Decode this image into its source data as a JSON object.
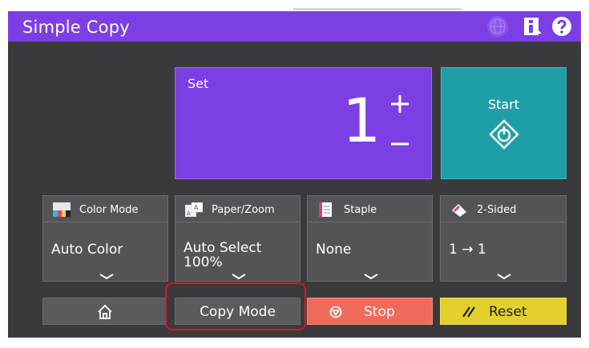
{
  "app": {
    "title": "Simple Copy"
  },
  "header_icons": [
    "web-icon",
    "info-icon",
    "help-icon"
  ],
  "set": {
    "label": "Set",
    "count": "1",
    "plus_symbol": "+",
    "minus_symbol": "–"
  },
  "start": {
    "label": "Start"
  },
  "functions": [
    {
      "label": "Color Mode",
      "value": "Auto Color",
      "value2": ""
    },
    {
      "label": "Paper/Zoom",
      "value": "Auto Select",
      "value2": "100%"
    },
    {
      "label": "Staple",
      "value": "None",
      "value2": ""
    },
    {
      "label": "2-Sided",
      "value": "1 → 1",
      "value2": ""
    }
  ],
  "bottom": {
    "copy_mode_label": "Copy Mode",
    "stop_label": "Stop",
    "reset_label": "Reset"
  },
  "colors": {
    "accent_purple": "#7b3fe4",
    "start_teal": "#1f9ea8",
    "stop_red": "#f06a5c",
    "reset_yellow": "#e3cf2e",
    "background_dark": "#3a3a3c",
    "highlight_red": "#e0141c"
  }
}
